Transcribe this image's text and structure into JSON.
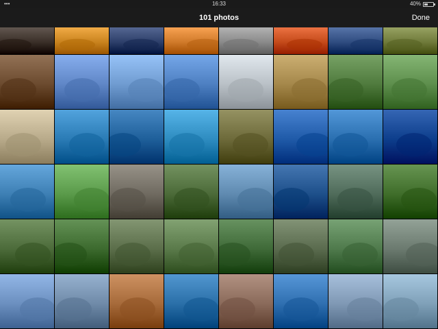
{
  "status_bar": {
    "time": "16:33",
    "battery": "40%",
    "battery_level": 0.4
  },
  "nav": {
    "title": "101 photos",
    "done_label": "Done"
  },
  "colors": {
    "bar": "#1b1b1b",
    "text": "#ffffff"
  },
  "thumbnails": [
    [
      "#3a2f28",
      "#c9831e",
      "#2d3f6a",
      "#d07a2a",
      "#8a8a8a",
      "#c44a1a",
      "#2f4c80",
      "#6f7a3a"
    ],
    [
      "#6b4a2e",
      "#5f86c6",
      "#6f9bd0",
      "#4d7fc1",
      "#b9c0c6",
      "#a4874a",
      "#4f7a3d",
      "#5d8e4c"
    ],
    [
      "#b8aa8a",
      "#2a7bb5",
      "#1e5f9a",
      "#2e8cc0",
      "#6d6a3a",
      "#1f5aa8",
      "#2a6fb0",
      "#0d3e8c"
    ],
    [
      "#3d7fb4",
      "#5a9a4a",
      "#6f6a60",
      "#4b6a38",
      "#5f8ab0",
      "#1d4f8a",
      "#4f6b5a",
      "#3f6d2a"
    ],
    [
      "#4c6b3a",
      "#3c6a2e",
      "#5b6e4a",
      "#5a7a4a",
      "#3f6a38",
      "#5a6b4e",
      "#4f7a4c",
      "#6b7a6f"
    ],
    [
      "#6b8fbf",
      "#6f8aa8",
      "#a66a3a",
      "#2a6fa8",
      "#8a6a5a",
      "#2f6fb0",
      "#7f98b4",
      "#7fa0b8"
    ]
  ]
}
